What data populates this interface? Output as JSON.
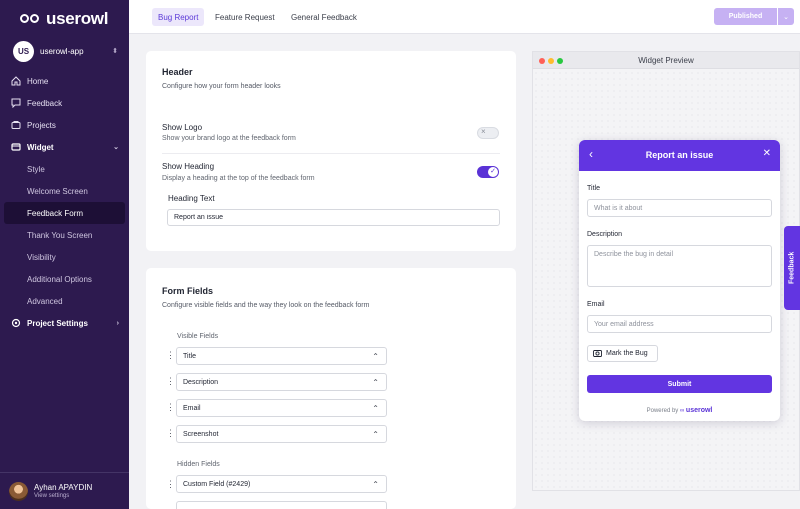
{
  "brand": {
    "name": "userowl"
  },
  "workspace": {
    "initials": "US",
    "name": "userowl-app"
  },
  "nav": {
    "home": "Home",
    "feedback": "Feedback",
    "projects": "Projects",
    "widget": "Widget",
    "sub": [
      "Style",
      "Welcome Screen",
      "Feedback Form",
      "Thank You Screen",
      "Visibility",
      "Additional Options",
      "Advanced"
    ],
    "project_settings": "Project Settings"
  },
  "user": {
    "name": "Ayhan APAYDIN",
    "link": "View settings"
  },
  "tabs": [
    "Bug Report",
    "Feature Request",
    "General Feedback"
  ],
  "publish": {
    "label": "Published"
  },
  "header_card": {
    "title": "Header",
    "desc": "Configure how your form header looks",
    "show_logo": {
      "label": "Show Logo",
      "desc": "Show your brand logo at the feedback form",
      "enabled": false
    },
    "show_heading": {
      "label": "Show Heading",
      "desc": "Display a heading at the top of the feedback form",
      "enabled": true
    },
    "heading_text": {
      "label": "Heading Text",
      "value": "Report an issue"
    }
  },
  "form_fields": {
    "title": "Form Fields",
    "desc": "Configure visible fields and the way they look on the feedback form",
    "visible_label": "Visible Fields",
    "visible": [
      "Title",
      "Description",
      "Email",
      "Screenshot"
    ],
    "hidden_label": "Hidden Fields",
    "hidden": [
      "Custom Field (#2429)"
    ]
  },
  "preview": {
    "title": "Widget Preview",
    "dot_colors": [
      "#ff5f57",
      "#febc2e",
      "#28c840"
    ],
    "widget": {
      "heading": "Report an issue",
      "title_label": "Title",
      "title_placeholder": "What is it about",
      "desc_label": "Description",
      "desc_placeholder": "Describe the bug in detail",
      "email_label": "Email",
      "email_placeholder": "Your email address",
      "mark_bug": "Mark the Bug",
      "submit": "Submit",
      "powered": "Powered by",
      "powered_brand": "userowl"
    },
    "side_tab": "Feedback"
  },
  "colors": {
    "sidebar": "#2d1a4f",
    "accent": "#6235e1",
    "publish": "#c6b1f3"
  }
}
